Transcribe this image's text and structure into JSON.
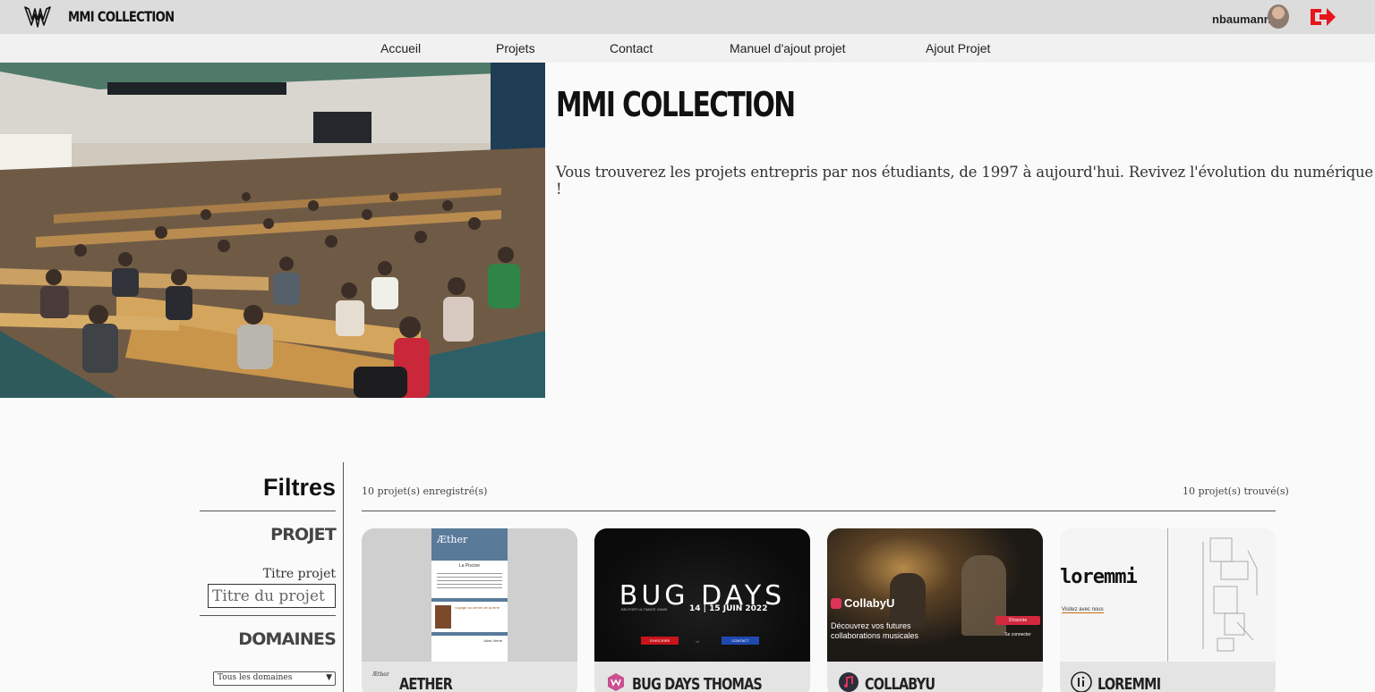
{
  "header": {
    "brand": "MMI COLLECTION",
    "username": "nbaumann"
  },
  "nav": {
    "items": [
      "Accueil",
      "Projets",
      "Contact",
      "Manuel d'ajout projet",
      "Ajout Projet"
    ]
  },
  "hero": {
    "title": "MMI COLLECTION",
    "text": "Vous trouverez les projets entrepris par nos étudiants, de 1997 à aujourd'hui. Revivez l'évolution du numérique !"
  },
  "filters": {
    "title": "Filtres",
    "projet_section": "PROJET",
    "titre_label": "Titre projet",
    "titre_placeholder": "Titre du projet",
    "domaines_section": "DOMAINES",
    "domaines_selected": "Tous les domaines"
  },
  "results": {
    "registered": "10 projet(s) enregistré(s)",
    "found": "10 projet(s) trouvé(s)"
  },
  "cards": [
    {
      "name": "AETHER",
      "logo_text": "Æther",
      "thumb_title": "Æther",
      "thumb_heading": "La Piscine",
      "thumb_item1": "Voyage au centre de la terre",
      "thumb_item2": "Jules Verne"
    },
    {
      "name": "BUG DAYS THOMAS",
      "thumb_title": "BUG DAYS",
      "thumb_sub": "BELFORT ULTIMATE GAME",
      "thumb_date": "14 | 15 JUIN 2022",
      "thumb_btn1": "S'INSCRIRE",
      "thumb_btn2": "CONTACT"
    },
    {
      "name": "COLLABYU",
      "thumb_title": "CollabyU",
      "thumb_text": "Découvrez vos futures collaborations musicales",
      "thumb_btn1": "S'inscrire",
      "thumb_btn2": "Se connecter"
    },
    {
      "name": "LOREMMI",
      "logo_text": "li",
      "thumb_title": "loremmi",
      "thumb_link": "Visitez avec nous"
    }
  ],
  "colors": {
    "topbar": "#dcdcdc",
    "navbar": "#f1f1f1",
    "logout": "#e8141c",
    "page_bg": "#fafafa"
  },
  "icons": {
    "logo": "mmi-flame-logo-icon",
    "logout": "logout-arrow-icon"
  }
}
